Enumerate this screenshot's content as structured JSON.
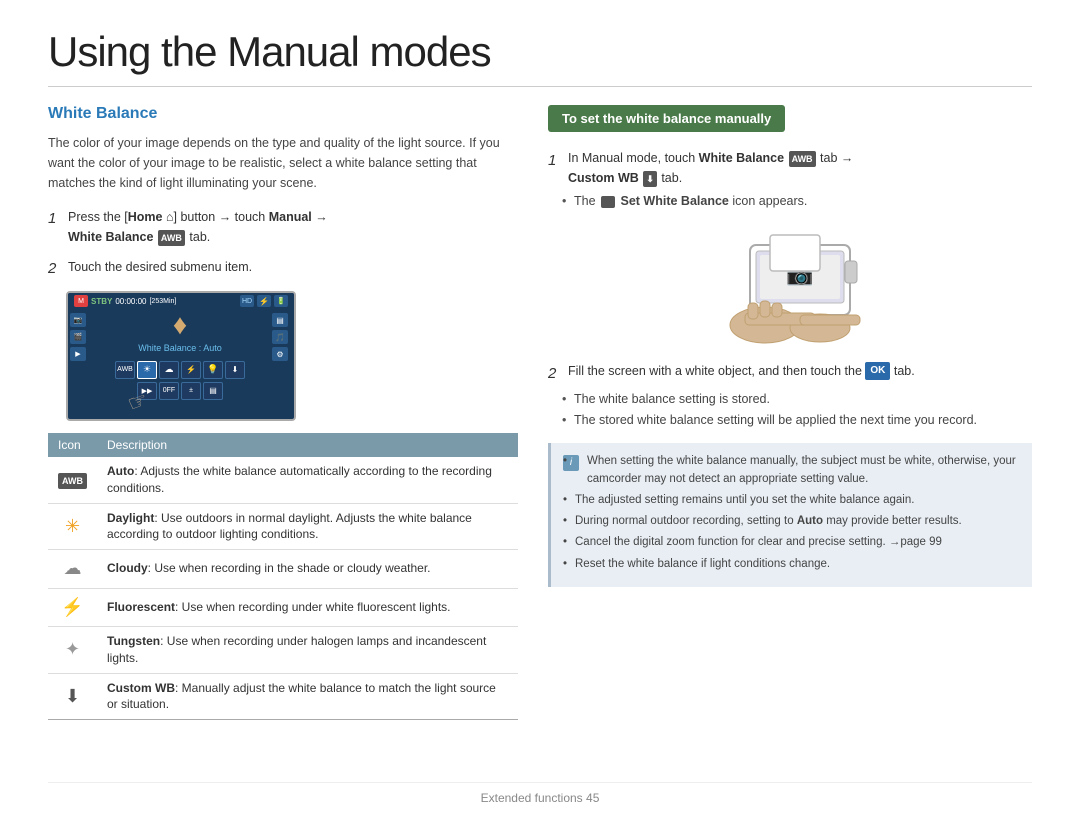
{
  "page": {
    "title": "Using the Manual modes",
    "footer": "Extended functions  45"
  },
  "left": {
    "section_title": "White Balance",
    "intro": "The color of your image depends on the type and quality of the light source. If you want the color of your image to be realistic, select a white balance setting that matches the kind of light illuminating your scene.",
    "step1": {
      "num": "1",
      "text_before": "Press the [",
      "home": "Home",
      "text_after": "] button → touch ",
      "manual": "Manual",
      "arrow": "→",
      "wb": "White Balance",
      "tab": " tab."
    },
    "step2": {
      "num": "2",
      "text": "Touch the desired submenu item."
    },
    "camera_screen": {
      "stby": "STBY",
      "time": "00:00:00",
      "min": "[253Min]",
      "wb_label": "White Balance : Auto"
    },
    "table": {
      "col1": "Icon",
      "col2": "Description",
      "rows": [
        {
          "icon_label": "AWB",
          "icon_type": "auto",
          "desc_bold": "Auto",
          "desc": ": Adjusts the white balance automatically according to the recording conditions."
        },
        {
          "icon_type": "sun",
          "desc_bold": "Daylight",
          "desc": ": Use outdoors in normal daylight. Adjusts the white balance according to outdoor lighting conditions."
        },
        {
          "icon_type": "cloud",
          "desc_bold": "Cloudy",
          "desc": ": Use when recording in the shade or cloudy weather."
        },
        {
          "icon_type": "fluor",
          "desc_bold": "Fluorescent",
          "desc": ": Use when recording under white fluorescent lights."
        },
        {
          "icon_type": "tungsten",
          "desc_bold": "Tungsten",
          "desc": ": Use when recording under halogen lamps and incandescent lights."
        },
        {
          "icon_type": "custom",
          "desc_bold": "Custom WB",
          "desc": ": Manually adjust the white balance to match the light source or situation."
        }
      ]
    }
  },
  "right": {
    "header": "To set the white balance manually",
    "step1": {
      "num": "1",
      "text": "In Manual mode, touch ",
      "bold": "White Balance",
      "tab_label": "AWB",
      "arrow": "tab →",
      "custom": "Custom WB",
      "custom_tab": "tab.",
      "bullet": "The",
      "bullet_bold": "Set White Balance",
      "bullet_end": "icon appears."
    },
    "step2": {
      "num": "2",
      "text_before": "Fill the screen with a white object, and then touch the",
      "ok": "OK",
      "text_after": "tab.",
      "bullets": [
        "The white balance setting is stored.",
        "The stored white balance setting will be applied the next time you record."
      ]
    },
    "notes": [
      "When setting the white balance manually, the subject must be white, otherwise, your camcorder may not detect an appropriate setting value.",
      "The adjusted setting remains until you set the white balance again.",
      "During normal outdoor recording, setting to Auto may provide better results.",
      "Cancel the digital zoom function for clear and precise setting. →page 99",
      "Reset the white balance if light conditions change."
    ],
    "notes_bold": [
      "Auto"
    ]
  }
}
